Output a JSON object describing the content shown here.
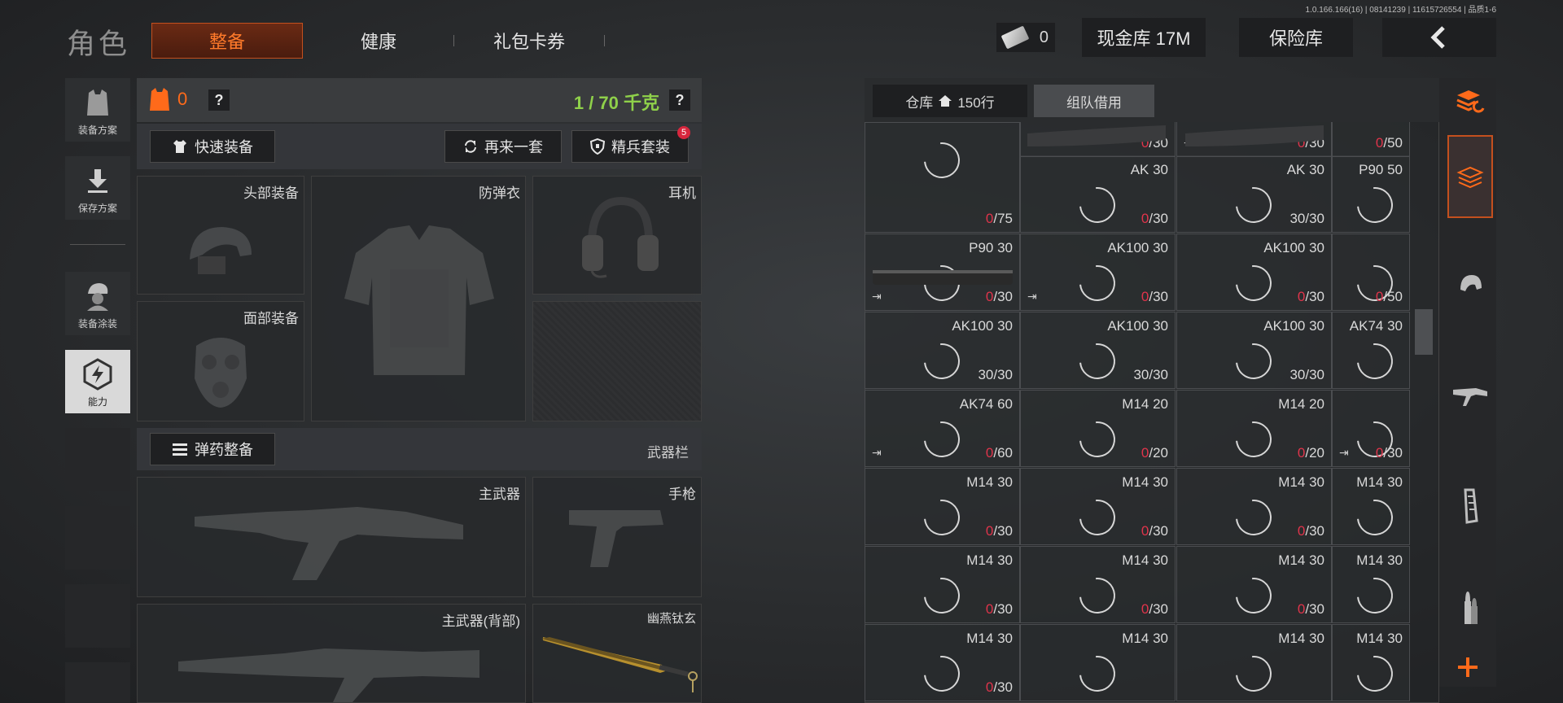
{
  "version_text": "1.0.166.166(16) | 08141239 | 11615726554 | 品质1-6",
  "header": {
    "title": "角色",
    "tabs": [
      {
        "label": "整备",
        "active": true
      },
      {
        "label": "健康",
        "active": false
      },
      {
        "label": "礼包卡券",
        "active": false
      }
    ],
    "cash_count": "0",
    "cash_vault_label": "现金库 17M",
    "safe_label": "保险库",
    "back_icon": "chevron-left-icon"
  },
  "side_nav": [
    {
      "label": "装备方案",
      "icon": "vest-icon"
    },
    {
      "label": "保存方案",
      "icon": "download-icon"
    },
    {
      "label": "装备涂装",
      "icon": "helmet-person-icon"
    },
    {
      "label": "能力",
      "icon": "lightning-hex-icon",
      "active": true
    }
  ],
  "loadout": {
    "vest_count": "0",
    "weight": "1 / 70 千克",
    "quick_equip": "快速装备",
    "reroll": "再来一套",
    "elite_set": "精兵套装",
    "elite_badge": "5",
    "slots": {
      "head": "头部装备",
      "armor": "防弹衣",
      "headset": "耳机",
      "face": "面部装备"
    },
    "ammo_equip": "弹药整备",
    "weapon_bar": "武器栏",
    "weapons": {
      "primary": "主武器",
      "pistol": "手枪",
      "primary_back": "主武器(背部)",
      "melee": "幽燕钛玄"
    }
  },
  "warehouse": {
    "tab_label": "仓库",
    "rows_label": "150行",
    "team_borrow": "组队借用",
    "items": [
      {
        "name": "",
        "cur": "0",
        "max": "/30",
        "zero": true,
        "extract": false
      },
      {
        "name": "",
        "cur": "0",
        "max": "/30",
        "zero": true,
        "extract": true
      },
      {
        "name": "",
        "cur": "0",
        "max": "/50",
        "zero": true,
        "extract": false
      },
      {
        "name": "",
        "cur": "0",
        "max": "/75",
        "zero": true,
        "extract": false
      },
      {
        "name": "AK 30",
        "cur": "0",
        "max": "/30",
        "zero": true,
        "extract": false
      },
      {
        "name": "AK 30",
        "cur": "30",
        "max": "/30",
        "zero": false,
        "extract": false
      },
      {
        "name": "P90 50",
        "cur": "",
        "max": "",
        "zero": false,
        "extract": false
      },
      {
        "name": "P90 30",
        "cur": "0",
        "max": "/30",
        "zero": true,
        "extract": true
      },
      {
        "name": "AK100 30",
        "cur": "0",
        "max": "/30",
        "zero": true,
        "extract": true
      },
      {
        "name": "AK100 30",
        "cur": "0",
        "max": "/30",
        "zero": true,
        "extract": false
      },
      {
        "name": "",
        "cur": "0",
        "max": "/50",
        "zero": true,
        "extract": false
      },
      {
        "name": "AK100 30",
        "cur": "30",
        "max": "/30",
        "zero": false,
        "extract": false
      },
      {
        "name": "AK100 30",
        "cur": "30",
        "max": "/30",
        "zero": false,
        "extract": false
      },
      {
        "name": "AK100 30",
        "cur": "30",
        "max": "/30",
        "zero": false,
        "extract": false
      },
      {
        "name": "AK74 30",
        "cur": "",
        "max": "",
        "zero": false,
        "extract": false
      },
      {
        "name": "AK74 60",
        "cur": "0",
        "max": "/60",
        "zero": true,
        "extract": true
      },
      {
        "name": "M14 20",
        "cur": "0",
        "max": "/20",
        "zero": true,
        "extract": false
      },
      {
        "name": "M14 20",
        "cur": "0",
        "max": "/20",
        "zero": true,
        "extract": false
      },
      {
        "name": "",
        "cur": "0",
        "max": "/30",
        "zero": true,
        "extract": true
      },
      {
        "name": "M14 30",
        "cur": "0",
        "max": "/30",
        "zero": true,
        "extract": false
      },
      {
        "name": "M14 30",
        "cur": "0",
        "max": "/30",
        "zero": true,
        "extract": false
      },
      {
        "name": "M14 30",
        "cur": "0",
        "max": "/30",
        "zero": true,
        "extract": false
      },
      {
        "name": "M14 30",
        "cur": "",
        "max": "",
        "zero": false,
        "extract": false
      },
      {
        "name": "M14 30",
        "cur": "0",
        "max": "/30",
        "zero": true,
        "extract": false
      },
      {
        "name": "M14 30",
        "cur": "0",
        "max": "/30",
        "zero": true,
        "extract": false
      },
      {
        "name": "M14 30",
        "cur": "0",
        "max": "/30",
        "zero": true,
        "extract": false
      },
      {
        "name": "M14 30",
        "cur": "0",
        "max": "/30",
        "zero": true,
        "extract": false
      },
      {
        "name": "M14 30",
        "cur": "",
        "max": "",
        "zero": false,
        "extract": false
      },
      {
        "name": "M14 30",
        "cur": "",
        "max": "",
        "zero": false,
        "extract": false
      },
      {
        "name": "M14 30",
        "cur": "",
        "max": "",
        "zero": false,
        "extract": false
      },
      {
        "name": "M14 30",
        "cur": "",
        "max": "",
        "zero": false,
        "extract": false
      }
    ]
  },
  "filters": [
    {
      "icon": "layers-refresh-icon"
    },
    {
      "icon": "layers-icon",
      "active": true
    },
    {
      "icon": "helmet-icon"
    },
    {
      "icon": "rifle-icon"
    },
    {
      "icon": "magazine-icon"
    },
    {
      "icon": "bullet-icon"
    },
    {
      "icon": "plus-icon"
    }
  ],
  "colors": {
    "accent": "#ff6a1a",
    "zero": "#e0344b",
    "weight": "#8fd14a"
  }
}
